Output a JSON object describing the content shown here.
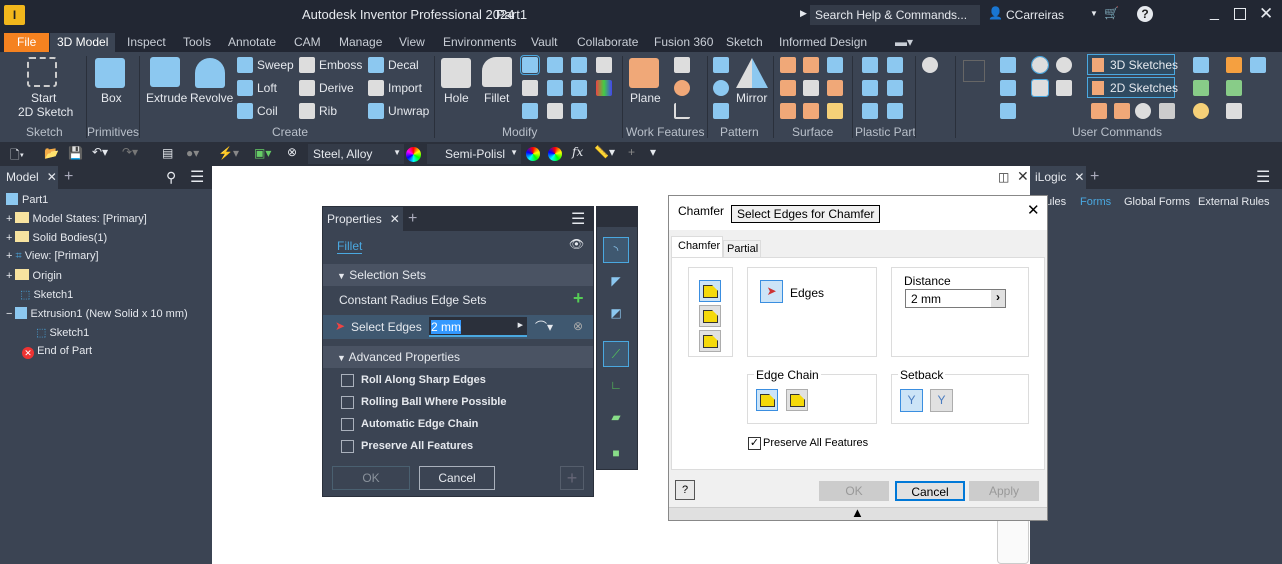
{
  "title": {
    "app": "Autodesk Inventor Professional 2024",
    "doc": "Part1",
    "search": "Search Help & Commands...",
    "user": "CCarreiras"
  },
  "tabs": [
    "File",
    "3D Model",
    "Inspect",
    "Tools",
    "Annotate",
    "CAM",
    "Manage",
    "View",
    "Environments",
    "Vault",
    "Collaborate",
    "Fusion 360",
    "Sketch",
    "Informed Design"
  ],
  "ribbon": {
    "sketch": {
      "btn1": "Start",
      "btn2": "2D Sketch",
      "label": "Sketch"
    },
    "primitives": {
      "btn": "Box",
      "label": "Primitives"
    },
    "create": {
      "extrude": "Extrude",
      "revolve": "Revolve",
      "sweep": "Sweep",
      "loft": "Loft",
      "coil": "Coil",
      "emboss": "Emboss",
      "derive": "Derive",
      "rib": "Rib",
      "decal": "Decal",
      "import": "Import",
      "unwrap": "Unwrap",
      "label": "Create"
    },
    "modify": {
      "hole": "Hole",
      "fillet": "Fillet",
      "label": "Modify"
    },
    "work": {
      "plane": "Plane",
      "label": "Work Features"
    },
    "pattern": {
      "mirror": "Mirror",
      "label": "Pattern"
    },
    "surface": {
      "label": "Surface"
    },
    "plastic": {
      "label": "Plastic Part"
    },
    "user": {
      "sk3d": "3D Sketches",
      "sk2d": "2D Sketches",
      "label": "User Commands"
    }
  },
  "qat": {
    "material": "Steel, Alloy",
    "appearance": "Semi-Polisl"
  },
  "browser": {
    "tab": "Model",
    "items": [
      "Part1",
      "Model States: [Primary]",
      "Solid Bodies(1)",
      "View: [Primary]",
      "Origin",
      "Sketch1",
      "Extrusion1 (New Solid x 10 mm)",
      "Sketch1",
      "End of Part"
    ]
  },
  "properties": {
    "tab": "Properties",
    "feature": "Fillet",
    "selection_sets": "Selection Sets",
    "edge_sets": "Constant Radius Edge Sets",
    "select_edges": "Select Edges",
    "radius": "2 mm",
    "advanced": "Advanced Properties",
    "options": [
      {
        "label": "Roll Along Sharp Edges",
        "checked": false
      },
      {
        "label": "Rolling Ball Where Possible",
        "checked": false
      },
      {
        "label": "Automatic Edge Chain",
        "checked": false
      },
      {
        "label": "Preserve All Features",
        "checked": false
      }
    ],
    "ok": "OK",
    "cancel": "Cancel"
  },
  "chamfer": {
    "title": "Chamfer",
    "tooltip": "Select Edges for Chamfer",
    "tab1": "Chamfer",
    "tab2": "Partial",
    "edges": "Edges",
    "distance_label": "Distance",
    "distance": "2 mm",
    "edge_chain": "Edge Chain",
    "setback": "Setback",
    "preserve": "Preserve All Features",
    "preserve_checked": true,
    "ok": "OK",
    "cancel": "Cancel",
    "apply": "Apply"
  },
  "ilogic": {
    "tab": "iLogic",
    "links": [
      "ules",
      "Forms",
      "Global Forms",
      "External Rules"
    ]
  },
  "colors": {
    "file_tab": "#f58220",
    "accent": "#4aa8e0",
    "panel": "#3b4453"
  }
}
